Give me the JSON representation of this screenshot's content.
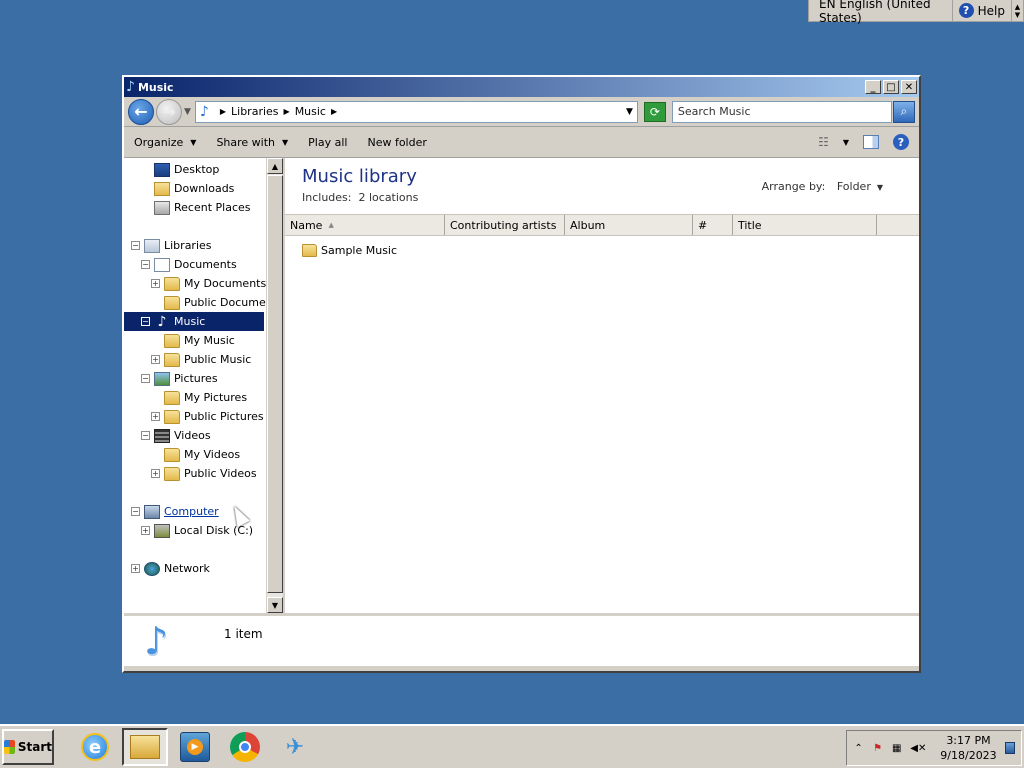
{
  "langbar": {
    "language": "EN English (United States)",
    "help": "Help"
  },
  "window": {
    "title": "Music"
  },
  "address": {
    "crumbs": [
      "Libraries",
      "Music"
    ],
    "search_placeholder": "Search Music"
  },
  "commands": {
    "organize": "Organize",
    "share": "Share with",
    "play_all": "Play all",
    "new_folder": "New folder"
  },
  "nav": {
    "desktop": "Desktop",
    "downloads": "Downloads",
    "recent": "Recent Places",
    "libraries": "Libraries",
    "documents": "Documents",
    "my_documents": "My Documents",
    "public_documents": "Public Documents",
    "music": "Music",
    "my_music": "My Music",
    "public_music": "Public Music",
    "pictures": "Pictures",
    "my_pictures": "My Pictures",
    "public_pictures": "Public Pictures",
    "videos": "Videos",
    "my_videos": "My Videos",
    "public_videos": "Public Videos",
    "computer": "Computer",
    "local_disk": "Local Disk (C:)",
    "network": "Network"
  },
  "library": {
    "title": "Music library",
    "includes_label": "Includes:",
    "includes_value": "2 locations",
    "arrange_label": "Arrange by:",
    "arrange_value": "Folder"
  },
  "columns": [
    "Name",
    "Contributing artists",
    "Album",
    "#",
    "Title"
  ],
  "files": [
    {
      "name": "Sample Music"
    }
  ],
  "details": {
    "count": "1 item"
  },
  "taskbar": {
    "start": "Start",
    "time": "3:17 PM",
    "date": "9/18/2023"
  },
  "colors": {
    "desktop": "#3a6ea5",
    "selection": "#0a246a",
    "title_text": "#1e3287"
  }
}
